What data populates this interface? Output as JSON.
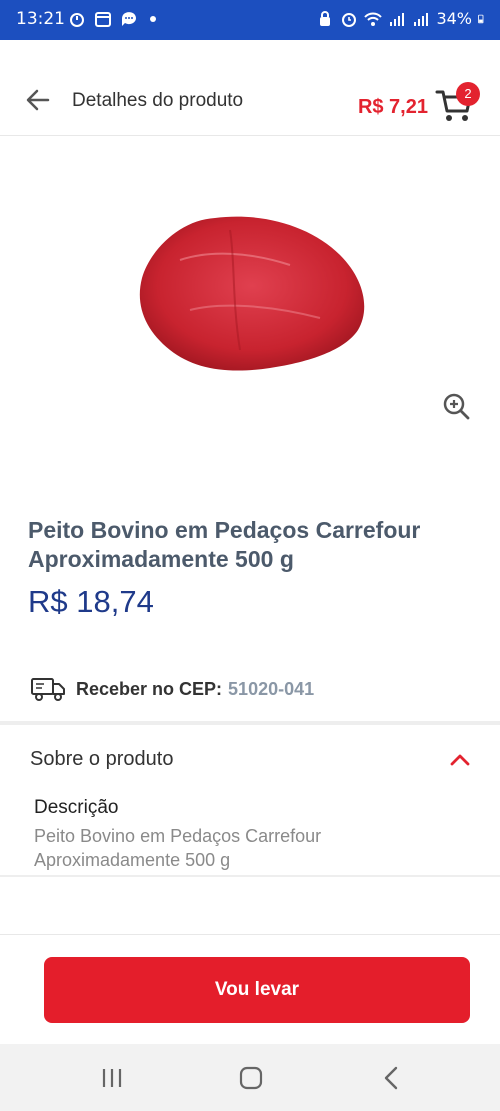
{
  "status_bar": {
    "time": "13:21",
    "battery": "34%",
    "bg_color": "#1c4fbf"
  },
  "header": {
    "title": "Detalhes do produto",
    "cart_total": "R$ 7,21",
    "cart_count": "2",
    "accent_color": "#e3232f"
  },
  "product": {
    "image_desc_icon": "beef-cut-image",
    "name": "Peito Bovino em Pedaços Carrefour Aproximadamente 500 g",
    "price": "R$ 18,74",
    "price_color": "#1f3a8a"
  },
  "delivery": {
    "label": "Receber no CEP:",
    "cep": "51020-041"
  },
  "about": {
    "title": "Sobre o produto",
    "description_title": "Descrição",
    "description_text": "Peito Bovino em Pedaços Carrefour Aproximadamente 500 g"
  },
  "cta": {
    "label": "Vou levar",
    "color": "#e41e2b"
  },
  "nav_bar": {
    "icons": [
      "recent-apps-icon",
      "home-icon",
      "back-icon"
    ]
  }
}
